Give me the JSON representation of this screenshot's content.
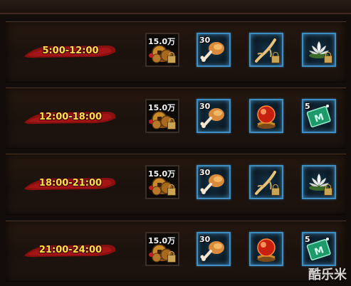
{
  "rows": [
    {
      "time": "5:00-12:00",
      "items": [
        {
          "icon": "copper-coin-icon",
          "qty": "15.0万",
          "locked": true,
          "frame": "plain"
        },
        {
          "icon": "roast-chicken-leg-icon",
          "qty": "30",
          "locked": false,
          "frame": "blue"
        },
        {
          "icon": "ginseng-root-icon",
          "qty": "",
          "locked": true,
          "frame": "blue"
        },
        {
          "icon": "white-lotus-icon",
          "qty": "",
          "locked": true,
          "frame": "blue"
        }
      ]
    },
    {
      "time": "12:00-18:00",
      "items": [
        {
          "icon": "copper-coin-icon",
          "qty": "15.0万",
          "locked": true,
          "frame": "plain"
        },
        {
          "icon": "roast-chicken-leg-icon",
          "qty": "30",
          "locked": false,
          "frame": "blue"
        },
        {
          "icon": "red-pearl-icon",
          "qty": "",
          "locked": false,
          "frame": "blue"
        },
        {
          "icon": "jade-token-icon",
          "qty": "5",
          "locked": false,
          "frame": "blue"
        }
      ]
    },
    {
      "time": "18:00-21:00",
      "items": [
        {
          "icon": "copper-coin-icon",
          "qty": "15.0万",
          "locked": true,
          "frame": "plain"
        },
        {
          "icon": "roast-chicken-leg-icon",
          "qty": "30",
          "locked": false,
          "frame": "blue"
        },
        {
          "icon": "ginseng-root-icon",
          "qty": "",
          "locked": true,
          "frame": "blue"
        },
        {
          "icon": "white-lotus-icon",
          "qty": "",
          "locked": true,
          "frame": "blue"
        }
      ]
    },
    {
      "time": "21:00-24:00",
      "items": [
        {
          "icon": "copper-coin-icon",
          "qty": "15.0万",
          "locked": true,
          "frame": "plain"
        },
        {
          "icon": "roast-chicken-leg-icon",
          "qty": "30",
          "locked": false,
          "frame": "blue"
        },
        {
          "icon": "red-pearl-icon",
          "qty": "",
          "locked": false,
          "frame": "blue"
        },
        {
          "icon": "jade-token-icon",
          "qty": "5",
          "locked": false,
          "frame": "blue"
        }
      ]
    }
  ],
  "watermark": "酷乐米",
  "colors": {
    "time_text": "#ffe24a",
    "ribbon": "#8a1010",
    "slot_glow": "#3f8fc7"
  }
}
